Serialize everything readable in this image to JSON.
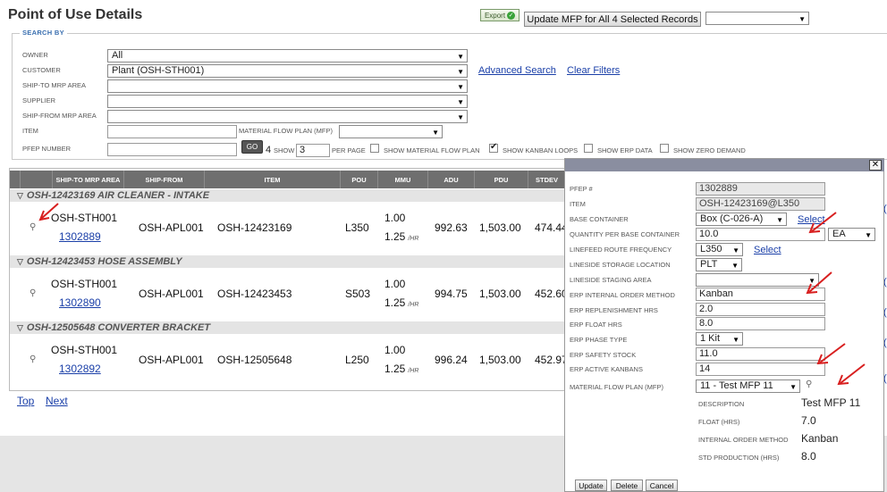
{
  "page": {
    "title": "Point of Use Details"
  },
  "toolbar": {
    "export_label": "Export",
    "update_all_label": "Update MFP for All 4 Selected Records",
    "bulk_select_value": ""
  },
  "search": {
    "legend": "SEARCH BY",
    "owner_label": "OWNER",
    "owner_value": "All",
    "customer_label": "CUSTOMER",
    "customer_value": "Plant (OSH-STH001)",
    "ship_to_label": "SHIP-TO MRP AREA",
    "ship_to_value": "",
    "supplier_label": "SUPPLIER",
    "supplier_value": "",
    "ship_from_label": "SHIP-FROM MRP AREA",
    "ship_from_value": "",
    "item_label": "ITEM",
    "item_value": "",
    "mfp_label": "MATERIAL FLOW PLAN (MFP)",
    "mfp_value": "",
    "pfep_label": "PFEP NUMBER",
    "pfep_value": "",
    "go_label": "GO",
    "count_value": "4",
    "show_label": "SHOW",
    "show_value": "3",
    "per_page_label": "PER PAGE",
    "show_mfp_label": "SHOW MATERIAL FLOW PLAN",
    "show_mfp_checked": false,
    "show_kanban_label": "SHOW KANBAN LOOPS",
    "show_kanban_checked": true,
    "show_erp_label": "SHOW ERP DATA",
    "show_erp_checked": false,
    "show_zero_label": "SHOW ZERO DEMAND",
    "show_zero_checked": false,
    "advanced_search": "Advanced Search",
    "clear_filters": "Clear Filters"
  },
  "grid": {
    "columns": [
      "SHIP-TO MRP AREA",
      "SHIP-FROM",
      "ITEM",
      "POU",
      "MMU",
      "ADU",
      "PDU",
      "STDEV"
    ],
    "hr_unit": "/HR",
    "groups": [
      {
        "title": "OSH-12423169 AIR CLEANER - INTAKE",
        "row": {
          "ship_to": "OSH-STH001",
          "pfep": "1302889",
          "ship_from": "OSH-APL001",
          "item": "OSH-12423169",
          "pou": "L350",
          "mmu_top": "1.00",
          "mmu_bottom": "1.25",
          "adu": "992.63",
          "pdu": "1,503.00",
          "stdev": "474.44"
        }
      },
      {
        "title": "OSH-12423453 HOSE ASSEMBLY",
        "row": {
          "ship_to": "OSH-STH001",
          "pfep": "1302890",
          "ship_from": "OSH-APL001",
          "item": "OSH-12423453",
          "pou": "S503",
          "mmu_top": "1.00",
          "mmu_bottom": "1.25",
          "adu": "994.75",
          "pdu": "1,503.00",
          "stdev": "452.60"
        }
      },
      {
        "title": "OSH-12505648 CONVERTER BRACKET",
        "row": {
          "ship_to": "OSH-STH001",
          "pfep": "1302892",
          "ship_from": "OSH-APL001",
          "item": "OSH-12505648",
          "pou": "L250",
          "mmu_top": "1.00",
          "mmu_bottom": "1.25",
          "adu": "996.24",
          "pdu": "1,503.00",
          "stdev": "452.97"
        }
      }
    ]
  },
  "pager": {
    "top": "Top",
    "next": "Next"
  },
  "dialog": {
    "close": "✕",
    "pfep_label": "PFEP #",
    "pfep_value": "1302889",
    "item_label": "ITEM",
    "item_value": "OSH-12423169@L350",
    "base_container_label": "BASE CONTAINER",
    "base_container_value": "Box (C-026-A)",
    "select_link": "Select",
    "qty_label": "QUANTITY PER BASE CONTAINER",
    "qty_value": "10.0",
    "qty_unit": "EA",
    "route_label": "LINEFEED ROUTE FREQUENCY",
    "route_value": "L350",
    "route_select": "Select",
    "storage_label": "LINESIDE STORAGE LOCATION",
    "storage_value": "PLT",
    "staging_label": "LINESIDE STAGING AREA",
    "staging_value": "",
    "order_method_label": "ERP INTERNAL ORDER METHOD",
    "order_method_value": "Kanban",
    "replenish_label": "ERP REPLENISHMENT HRS",
    "replenish_value": "2.0",
    "float_label": "ERP FLOAT HRS",
    "float_value": "8.0",
    "phase_label": "ERP PHASE TYPE",
    "phase_value": "1 Kit",
    "safety_label": "ERP SAFETY STOCK",
    "safety_value": "11.0",
    "kanbans_label": "ERP ACTIVE KANBANS",
    "kanbans_value": "14",
    "mfp_label": "MATERIAL FLOW PLAN (MFP)",
    "mfp_value": "11 - Test MFP 11",
    "desc_label": "DESCRIPTION",
    "desc_value": "Test MFP 11",
    "float_hrs_label": "FLOAT (HRS)",
    "float_hrs_value": "7.0",
    "iom_label": "INTERNAL ORDER METHOD",
    "iom_value": "Kanban",
    "std_label": "STD PRODUCTION (HRS)",
    "std_value": "8.0",
    "update_btn": "Update",
    "delete_btn": "Delete",
    "cancel_btn": "Cancel"
  },
  "colors": {
    "header_gray": "#6f6f6f",
    "link_blue": "#1a3fa8",
    "annotation_red": "#d81f1f",
    "dialog_title": "#8a8ea0"
  }
}
